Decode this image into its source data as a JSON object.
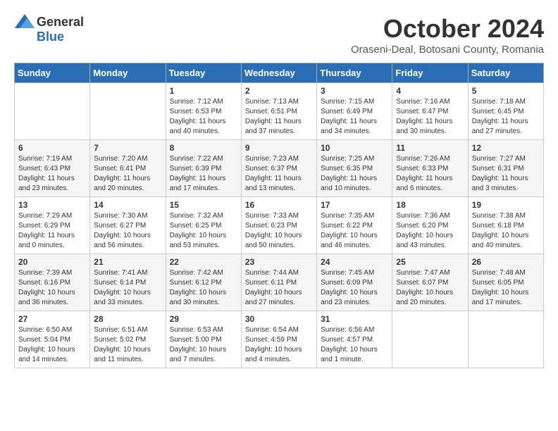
{
  "header": {
    "logo_general": "General",
    "logo_blue": "Blue",
    "month_title": "October 2024",
    "location": "Oraseni-Deal, Botosani County, Romania"
  },
  "days_of_week": [
    "Sunday",
    "Monday",
    "Tuesday",
    "Wednesday",
    "Thursday",
    "Friday",
    "Saturday"
  ],
  "weeks": [
    [
      {
        "day": "",
        "sunrise": "",
        "sunset": "",
        "daylight": ""
      },
      {
        "day": "",
        "sunrise": "",
        "sunset": "",
        "daylight": ""
      },
      {
        "day": "1",
        "sunrise": "Sunrise: 7:12 AM",
        "sunset": "Sunset: 6:53 PM",
        "daylight": "Daylight: 11 hours and 40 minutes."
      },
      {
        "day": "2",
        "sunrise": "Sunrise: 7:13 AM",
        "sunset": "Sunset: 6:51 PM",
        "daylight": "Daylight: 11 hours and 37 minutes."
      },
      {
        "day": "3",
        "sunrise": "Sunrise: 7:15 AM",
        "sunset": "Sunset: 6:49 PM",
        "daylight": "Daylight: 11 hours and 34 minutes."
      },
      {
        "day": "4",
        "sunrise": "Sunrise: 7:16 AM",
        "sunset": "Sunset: 6:47 PM",
        "daylight": "Daylight: 11 hours and 30 minutes."
      },
      {
        "day": "5",
        "sunrise": "Sunrise: 7:18 AM",
        "sunset": "Sunset: 6:45 PM",
        "daylight": "Daylight: 11 hours and 27 minutes."
      }
    ],
    [
      {
        "day": "6",
        "sunrise": "Sunrise: 7:19 AM",
        "sunset": "Sunset: 6:43 PM",
        "daylight": "Daylight: 11 hours and 23 minutes."
      },
      {
        "day": "7",
        "sunrise": "Sunrise: 7:20 AM",
        "sunset": "Sunset: 6:41 PM",
        "daylight": "Daylight: 11 hours and 20 minutes."
      },
      {
        "day": "8",
        "sunrise": "Sunrise: 7:22 AM",
        "sunset": "Sunset: 6:39 PM",
        "daylight": "Daylight: 11 hours and 17 minutes."
      },
      {
        "day": "9",
        "sunrise": "Sunrise: 7:23 AM",
        "sunset": "Sunset: 6:37 PM",
        "daylight": "Daylight: 11 hours and 13 minutes."
      },
      {
        "day": "10",
        "sunrise": "Sunrise: 7:25 AM",
        "sunset": "Sunset: 6:35 PM",
        "daylight": "Daylight: 11 hours and 10 minutes."
      },
      {
        "day": "11",
        "sunrise": "Sunrise: 7:26 AM",
        "sunset": "Sunset: 6:33 PM",
        "daylight": "Daylight: 11 hours and 6 minutes."
      },
      {
        "day": "12",
        "sunrise": "Sunrise: 7:27 AM",
        "sunset": "Sunset: 6:31 PM",
        "daylight": "Daylight: 11 hours and 3 minutes."
      }
    ],
    [
      {
        "day": "13",
        "sunrise": "Sunrise: 7:29 AM",
        "sunset": "Sunset: 6:29 PM",
        "daylight": "Daylight: 11 hours and 0 minutes."
      },
      {
        "day": "14",
        "sunrise": "Sunrise: 7:30 AM",
        "sunset": "Sunset: 6:27 PM",
        "daylight": "Daylight: 10 hours and 56 minutes."
      },
      {
        "day": "15",
        "sunrise": "Sunrise: 7:32 AM",
        "sunset": "Sunset: 6:25 PM",
        "daylight": "Daylight: 10 hours and 53 minutes."
      },
      {
        "day": "16",
        "sunrise": "Sunrise: 7:33 AM",
        "sunset": "Sunset: 6:23 PM",
        "daylight": "Daylight: 10 hours and 50 minutes."
      },
      {
        "day": "17",
        "sunrise": "Sunrise: 7:35 AM",
        "sunset": "Sunset: 6:22 PM",
        "daylight": "Daylight: 10 hours and 46 minutes."
      },
      {
        "day": "18",
        "sunrise": "Sunrise: 7:36 AM",
        "sunset": "Sunset: 6:20 PM",
        "daylight": "Daylight: 10 hours and 43 minutes."
      },
      {
        "day": "19",
        "sunrise": "Sunrise: 7:38 AM",
        "sunset": "Sunset: 6:18 PM",
        "daylight": "Daylight: 10 hours and 40 minutes."
      }
    ],
    [
      {
        "day": "20",
        "sunrise": "Sunrise: 7:39 AM",
        "sunset": "Sunset: 6:16 PM",
        "daylight": "Daylight: 10 hours and 36 minutes."
      },
      {
        "day": "21",
        "sunrise": "Sunrise: 7:41 AM",
        "sunset": "Sunset: 6:14 PM",
        "daylight": "Daylight: 10 hours and 33 minutes."
      },
      {
        "day": "22",
        "sunrise": "Sunrise: 7:42 AM",
        "sunset": "Sunset: 6:12 PM",
        "daylight": "Daylight: 10 hours and 30 minutes."
      },
      {
        "day": "23",
        "sunrise": "Sunrise: 7:44 AM",
        "sunset": "Sunset: 6:11 PM",
        "daylight": "Daylight: 10 hours and 27 minutes."
      },
      {
        "day": "24",
        "sunrise": "Sunrise: 7:45 AM",
        "sunset": "Sunset: 6:09 PM",
        "daylight": "Daylight: 10 hours and 23 minutes."
      },
      {
        "day": "25",
        "sunrise": "Sunrise: 7:47 AM",
        "sunset": "Sunset: 6:07 PM",
        "daylight": "Daylight: 10 hours and 20 minutes."
      },
      {
        "day": "26",
        "sunrise": "Sunrise: 7:48 AM",
        "sunset": "Sunset: 6:05 PM",
        "daylight": "Daylight: 10 hours and 17 minutes."
      }
    ],
    [
      {
        "day": "27",
        "sunrise": "Sunrise: 6:50 AM",
        "sunset": "Sunset: 5:04 PM",
        "daylight": "Daylight: 10 hours and 14 minutes."
      },
      {
        "day": "28",
        "sunrise": "Sunrise: 6:51 AM",
        "sunset": "Sunset: 5:02 PM",
        "daylight": "Daylight: 10 hours and 11 minutes."
      },
      {
        "day": "29",
        "sunrise": "Sunrise: 6:53 AM",
        "sunset": "Sunset: 5:00 PM",
        "daylight": "Daylight: 10 hours and 7 minutes."
      },
      {
        "day": "30",
        "sunrise": "Sunrise: 6:54 AM",
        "sunset": "Sunset: 4:59 PM",
        "daylight": "Daylight: 10 hours and 4 minutes."
      },
      {
        "day": "31",
        "sunrise": "Sunrise: 6:56 AM",
        "sunset": "Sunset: 4:57 PM",
        "daylight": "Daylight: 10 hours and 1 minute."
      },
      {
        "day": "",
        "sunrise": "",
        "sunset": "",
        "daylight": ""
      },
      {
        "day": "",
        "sunrise": "",
        "sunset": "",
        "daylight": ""
      }
    ]
  ]
}
